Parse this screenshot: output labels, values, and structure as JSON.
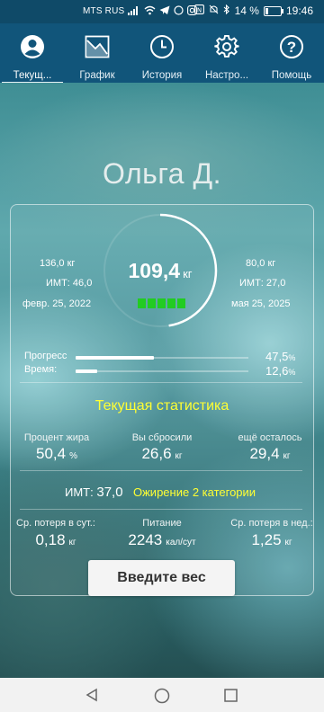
{
  "status": {
    "carrier": "MTS RUS",
    "battery": "14 %",
    "time": "19:46"
  },
  "tabs": [
    {
      "label": "Текущ...",
      "icon": "profile-icon",
      "active": true
    },
    {
      "label": "График",
      "icon": "chart-icon",
      "active": false
    },
    {
      "label": "История",
      "icon": "clock-icon",
      "active": false
    },
    {
      "label": "Настро...",
      "icon": "gear-icon",
      "active": false
    },
    {
      "label": "Помощь",
      "icon": "help-icon",
      "active": false
    }
  ],
  "user": {
    "name": "Ольга Д."
  },
  "weights": {
    "start": "136,0 кг",
    "start_bmi": "ИМТ: 46,0",
    "start_date": "февр. 25, 2022",
    "current": "109,4",
    "current_unit": "кг",
    "target": "80,0 кг",
    "target_bmi": "ИМТ: 27,0",
    "target_date": "мая 25, 2025",
    "green_blocks": 5
  },
  "progress": {
    "progress_label": "Прогресс",
    "progress_value": "47,5",
    "progress_fraction": 0.475,
    "time_label": "Время:",
    "time_value": "12,6",
    "time_fraction": 0.126,
    "percent_sign": "%",
    "ring_fraction": 0.475
  },
  "stats": {
    "title": "Текущая статистика",
    "fat_label": "Процент жира",
    "fat_value": "50,4",
    "fat_unit": "%",
    "lost_label": "Вы сбросили",
    "lost_value": "26,6",
    "lost_unit": "кг",
    "left_label": "ещё осталось",
    "left_value": "29,4",
    "left_unit": "кг",
    "bmi_label": "ИМТ:",
    "bmi_value": "37,0",
    "bmi_category": "Ожирение 2 категории",
    "daily_label": "Ср. потеря в сут.:",
    "daily_value": "0,18",
    "daily_unit": "кг",
    "food_label": "Питание",
    "food_value": "2243",
    "food_unit": "кал/сут",
    "weekly_label": "Ср. потеря в нед.:",
    "weekly_value": "1,25",
    "weekly_unit": "кг"
  },
  "actions": {
    "enter_weight": "Введите вес"
  },
  "colors": {
    "nav": "#11557a",
    "accent_yellow": "#ffff33",
    "progress_green": "#22cc22"
  }
}
